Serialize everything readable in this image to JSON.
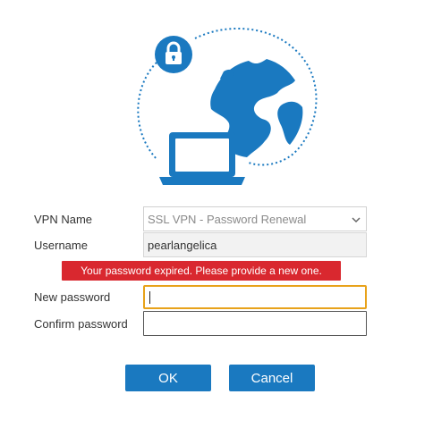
{
  "form": {
    "vpn_name_label": "VPN Name",
    "vpn_name_value": "SSL VPN - Password Renewal",
    "username_label": "Username",
    "username_value": "pearlangelica",
    "error_message": "Your password expired. Please provide a new one.",
    "new_password_label": "New password",
    "confirm_password_label": "Confirm password"
  },
  "buttons": {
    "ok_label": "OK",
    "cancel_label": "Cancel"
  },
  "icons": {
    "lock": "lock-icon",
    "globe": "globe-icon",
    "laptop": "laptop-icon",
    "dropdown": "chevron-down-icon"
  },
  "colors": {
    "brand_blue": "#1a79c0",
    "error_red": "#d9282f",
    "focus_orange": "#e8a21a"
  }
}
